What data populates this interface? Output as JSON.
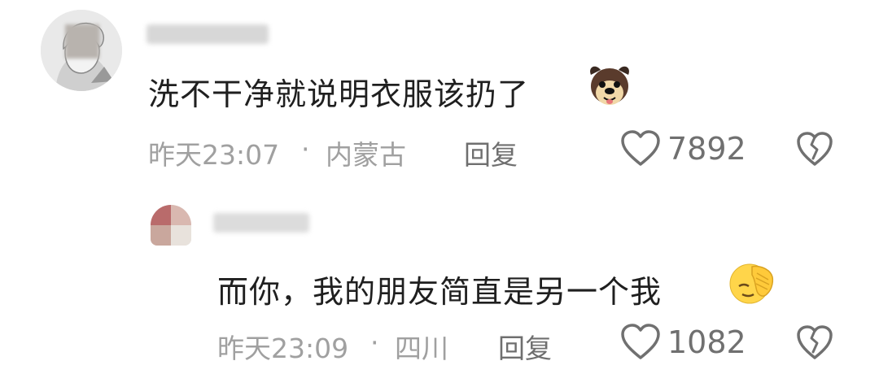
{
  "comments": [
    {
      "text": "洗不干净就说明衣服该扔了",
      "emoji_icon": "dog-face-icon",
      "time": "昨天23:07",
      "separator": "·",
      "location": "内蒙古",
      "reply_label": "回复",
      "likes": "7892"
    },
    {
      "text": "而你，我的朋友简直是另一个我",
      "emoji_icon": "face-palm-icon",
      "time": "昨天23:09",
      "separator": "·",
      "location": "四川",
      "reply_label": "回复",
      "likes": "1082"
    }
  ]
}
